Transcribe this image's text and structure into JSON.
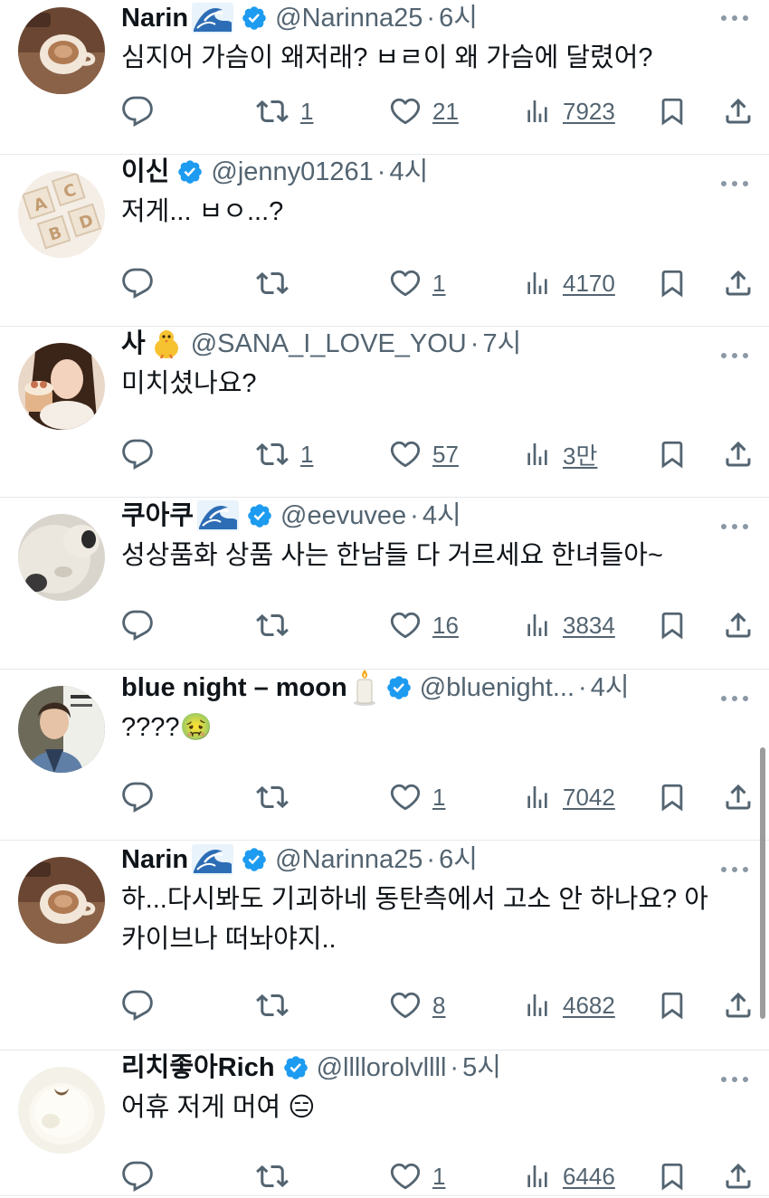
{
  "colors": {
    "verified": "#1d9bf0",
    "text": "#0f1419",
    "muted": "#536471",
    "divider": "#e6e9ec"
  },
  "tweets": [
    {
      "name": "Narin",
      "name_emoji": "wave-emoji",
      "verified": true,
      "handle": "@Narinna25",
      "time": "6시",
      "text": "심지어 가슴이 왜저래? ㅂㄹ이 왜 가슴에 달렸어?",
      "avatar": "coffee-cup-photo",
      "replies": "",
      "retweets": "1",
      "likes": "21",
      "views": "7923"
    },
    {
      "name": "이신",
      "name_emoji": "",
      "verified": true,
      "handle": "@jenny01261",
      "time": "4시",
      "text": "저게... ㅂㅇ...?",
      "avatar": "letter-blocks-photo",
      "replies": "",
      "retweets": "",
      "likes": "1",
      "views": "4170"
    },
    {
      "name": "사",
      "name_emoji": "chick-emoji",
      "verified": false,
      "handle": "@SANA_I_LOVE_YOU",
      "time": "7시",
      "text": "미치셨나요?",
      "avatar": "person-with-cupcake-photo",
      "replies": "",
      "retweets": "1",
      "likes": "57",
      "views": "3만"
    },
    {
      "name": "쿠아쿠",
      "name_emoji": "wave-emoji",
      "verified": true,
      "handle": "@eevuvee",
      "time": "4시",
      "text": "성상품화 상품 사는 한남들 다 거르세요 한녀들아~",
      "avatar": "fluffy-animal-photo",
      "replies": "",
      "retweets": "",
      "likes": "16",
      "views": "3834"
    },
    {
      "name": "blue night – moon",
      "name_emoji": "candle-emoji",
      "verified": true,
      "handle": "@bluenight...",
      "time": "4시",
      "text": "????🤢",
      "avatar": "person-portrait-photo",
      "replies": "",
      "retweets": "",
      "likes": "1",
      "views": "7042"
    },
    {
      "name": "Narin",
      "name_emoji": "wave-emoji",
      "verified": true,
      "handle": "@Narinna25",
      "time": "6시",
      "text": "하...다시봐도 기괴하네 동탄측에서 고소 안 하나요? 아\n카이브나 떠놔야지..",
      "avatar": "coffee-cup-photo",
      "replies": "",
      "retweets": "",
      "likes": "8",
      "views": "4682"
    },
    {
      "name": "리치좋아Rich",
      "name_emoji": "",
      "verified": true,
      "handle": "@llllorolvllll",
      "time": "5시",
      "text": "어휴 저게 머여 😑",
      "avatar": "white-round-object-photo",
      "replies": "",
      "retweets": "",
      "likes": "1",
      "views": "6446"
    }
  ]
}
